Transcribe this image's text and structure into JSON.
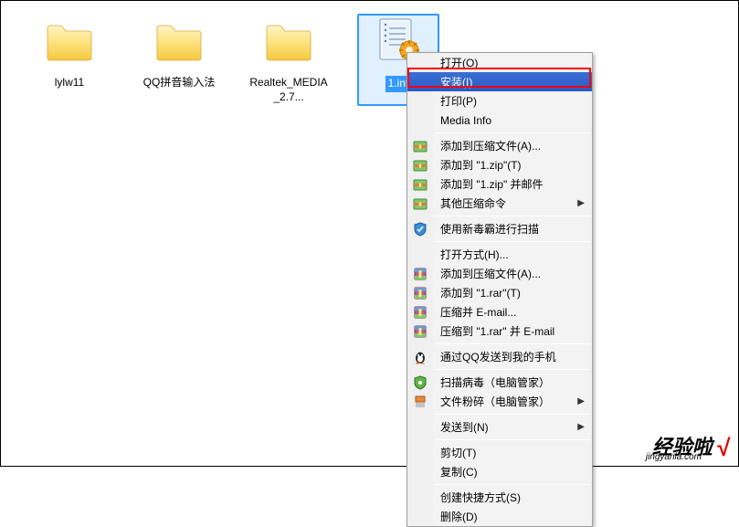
{
  "files": [
    {
      "label": "lylw11",
      "type": "folder"
    },
    {
      "label": "QQ拼音输入法",
      "type": "folder"
    },
    {
      "label": "Realtek_MEDIA_2.7...",
      "type": "folder"
    },
    {
      "label": "1.inf",
      "type": "inf",
      "selected": true
    }
  ],
  "menu": {
    "items": [
      {
        "label": "打开(O)",
        "icon": ""
      },
      {
        "label": "安装(I)",
        "icon": "",
        "highlighted": true
      },
      {
        "label": "打印(P)",
        "icon": ""
      },
      {
        "label": "Media Info",
        "icon": ""
      },
      {
        "sep": true
      },
      {
        "label": "添加到压缩文件(A)...",
        "icon": "zip"
      },
      {
        "label": "添加到 \"1.zip\"(T)",
        "icon": "zip"
      },
      {
        "label": "添加到 \"1.zip\" 并邮件",
        "icon": "zip"
      },
      {
        "label": "其他压缩命令",
        "icon": "zip",
        "submenu": true
      },
      {
        "sep": true
      },
      {
        "label": "使用新毒霸进行扫描",
        "icon": "shield-blue"
      },
      {
        "sep": true
      },
      {
        "label": "打开方式(H)...",
        "icon": ""
      },
      {
        "label": "添加到压缩文件(A)...",
        "icon": "rar"
      },
      {
        "label": "添加到 \"1.rar\"(T)",
        "icon": "rar"
      },
      {
        "label": "压缩并 E-mail...",
        "icon": "rar"
      },
      {
        "label": "压缩到 \"1.rar\" 并 E-mail",
        "icon": "rar"
      },
      {
        "sep": true
      },
      {
        "label": "通过QQ发送到我的手机",
        "icon": "qq"
      },
      {
        "sep": true
      },
      {
        "label": "扫描病毒（电脑管家）",
        "icon": "shield-green"
      },
      {
        "label": "文件粉碎（电脑管家）",
        "icon": "shred",
        "submenu": true
      },
      {
        "sep": true
      },
      {
        "label": "发送到(N)",
        "icon": "",
        "submenu": true
      },
      {
        "sep": true
      },
      {
        "label": "剪切(T)",
        "icon": ""
      },
      {
        "label": "复制(C)",
        "icon": ""
      },
      {
        "sep": true
      },
      {
        "label": "创建快捷方式(S)",
        "icon": ""
      },
      {
        "label": "删除(D)",
        "icon": ""
      }
    ]
  },
  "watermark": {
    "main": "经验啦",
    "sub": "jingyanla.com",
    "check": "√"
  }
}
